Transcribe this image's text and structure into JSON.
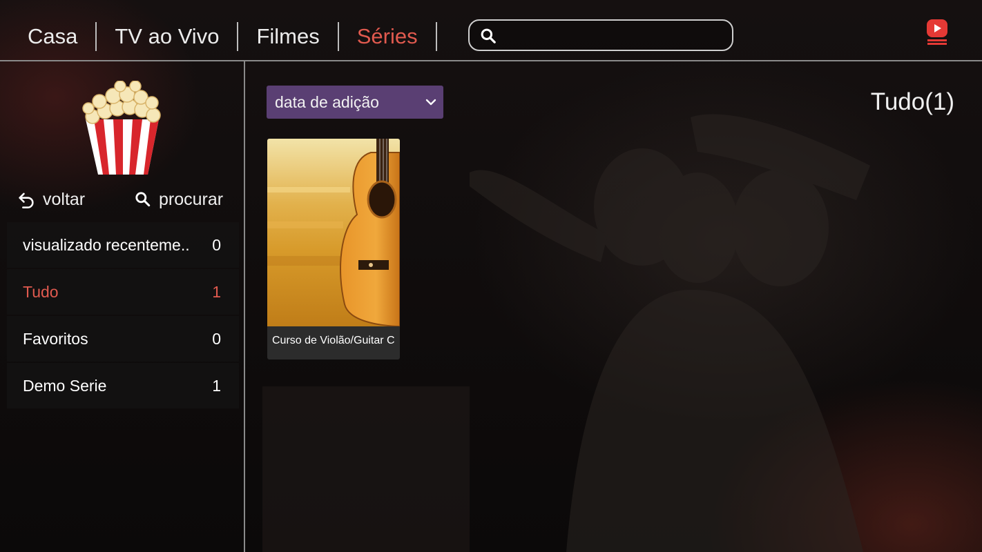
{
  "nav": {
    "tabs": [
      {
        "label": "Casa"
      },
      {
        "label": "TV ao Vivo"
      },
      {
        "label": "Filmes"
      },
      {
        "label": "Séries"
      }
    ],
    "active_tab": "Séries",
    "search_value": ""
  },
  "logo": {
    "icon": "youtube-play-icon",
    "color": "#e53935"
  },
  "sidebar": {
    "back_label": "voltar",
    "search_label": "procurar",
    "categories": [
      {
        "label": "visualizado recenteme..",
        "count": "0"
      },
      {
        "label": "Tudo",
        "count": "1"
      },
      {
        "label": "Favoritos",
        "count": "0"
      },
      {
        "label": "Demo Serie",
        "count": "1"
      }
    ],
    "active_category": "Tudo"
  },
  "main": {
    "sort_label": "data de adição",
    "total_label": "Tudo(1)",
    "series": [
      {
        "title": "Curso de Violão/Guitar C",
        "poster_icon": "guitar-poster"
      }
    ]
  },
  "colors": {
    "accent": "#e15a4f",
    "sort_bg": "#5a3f73",
    "card_bg": "#2c2c2c"
  }
}
